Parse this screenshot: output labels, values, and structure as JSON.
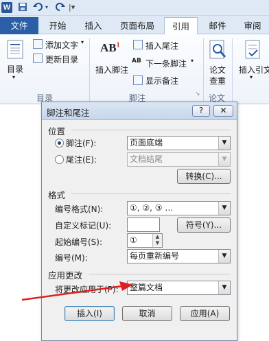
{
  "quick_access": {
    "undo_icon": "undo-icon",
    "redo_icon": "redo-icon",
    "save_icon": "save-icon",
    "customize_glyph": "|▾"
  },
  "tabs": [
    {
      "label": "文件"
    },
    {
      "label": "开始"
    },
    {
      "label": "插入"
    },
    {
      "label": "页面布局"
    },
    {
      "label": "引用"
    },
    {
      "label": "邮件"
    },
    {
      "label": "审阅"
    }
  ],
  "ribbon": {
    "toc": {
      "label": "目录",
      "group": "目录"
    },
    "footnote_group": {
      "insert_footnote": "插入脚注",
      "insert_endnote": "插入尾注",
      "next_footnote": "下一条脚注",
      "show_notes": "显示备注",
      "add_text": "添加文字",
      "update_toc": "更新目录",
      "group": "脚注",
      "ab_glyph": "AB",
      "ab_sup": "1",
      "small_ab": "AB"
    },
    "research": {
      "line1": "论文",
      "line2": "查重",
      "group": "论文"
    },
    "citation": {
      "label": "插入引文"
    }
  },
  "dialog": {
    "title": "脚注和尾注",
    "help_label": "?",
    "close_label": "✕",
    "position_section": "位置",
    "footnote_label": "脚注(F):",
    "footnote_value": "页面底端",
    "endnote_label": "尾注(E):",
    "endnote_value": "文档结尾",
    "convert_label": "转换(C)...",
    "format_section": "格式",
    "number_format_label": "编号格式(N):",
    "number_format_value": "①, ②, ③ …",
    "custom_mark_label": "自定义标记(U):",
    "custom_mark_value": "",
    "symbol_label": "符号(Y)...",
    "start_at_label": "起始编号(S):",
    "start_at_value": "①",
    "numbering_label": "编号(M):",
    "numbering_value": "每页重新编号",
    "apply_section": "应用更改",
    "apply_to_label": "将更改应用于(P):",
    "apply_to_value": "整篇文档",
    "insert_label": "插入(I)",
    "cancel_label": "取消",
    "apply_label": "应用(A)"
  },
  "colors": {
    "annotation_arrow": "#e02020",
    "file_tab": "#2a5fa7"
  }
}
